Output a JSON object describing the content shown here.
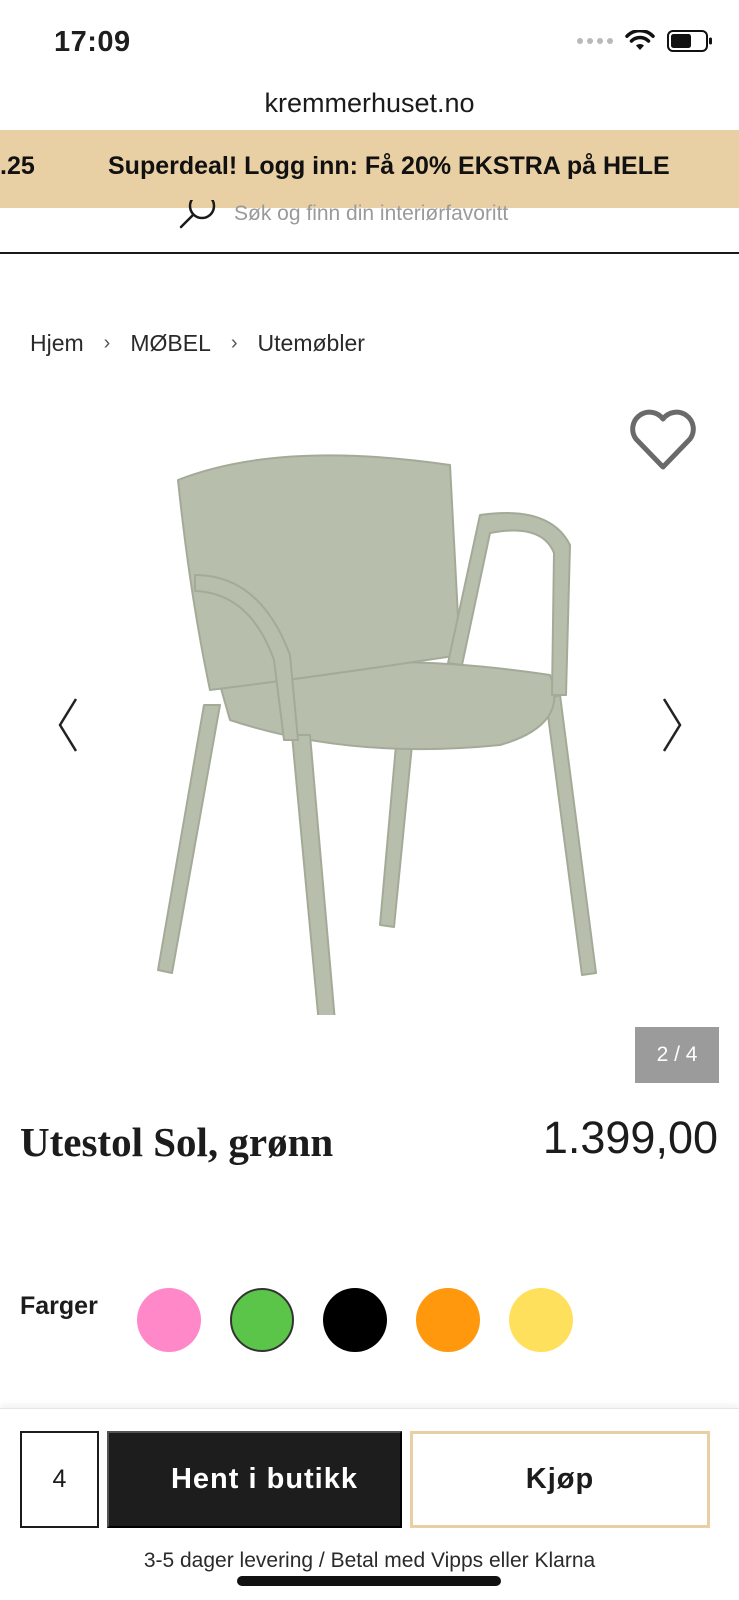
{
  "status_bar": {
    "time": "17:09",
    "icons": [
      "signal-icon",
      "wifi-icon",
      "battery-icon"
    ]
  },
  "browser": {
    "url": "kremmerhuset.no"
  },
  "promo": {
    "left_fragment": ".25",
    "text": "Superdeal! Logg inn: Få 20% EKSTRA på HELE",
    "background": "#e9cfa4"
  },
  "search": {
    "placeholder": "Søk og finn din interiørfavoritt"
  },
  "breadcrumb": [
    "Hjem",
    "MØBEL",
    "Utemøbler"
  ],
  "gallery": {
    "counter": "2 / 4",
    "current": 2,
    "total": 4
  },
  "product": {
    "title": "Utestol Sol, grønn",
    "price": "1.399,00"
  },
  "colors": {
    "label": "Farger",
    "swatches": [
      {
        "name": "pink",
        "hex": "#ff88c8"
      },
      {
        "name": "green",
        "hex": "#5bc54a",
        "selected": true
      },
      {
        "name": "black",
        "hex": "#000000"
      },
      {
        "name": "orange",
        "hex": "#ff980d"
      },
      {
        "name": "yellow",
        "hex": "#ffe05c"
      }
    ]
  },
  "purchase": {
    "quantity": "4",
    "pickup_label": "Hent i butikk",
    "buy_label": "Kjøp",
    "delivery_info": "3-5 dager levering / Betal med Vipps eller Klarna"
  }
}
